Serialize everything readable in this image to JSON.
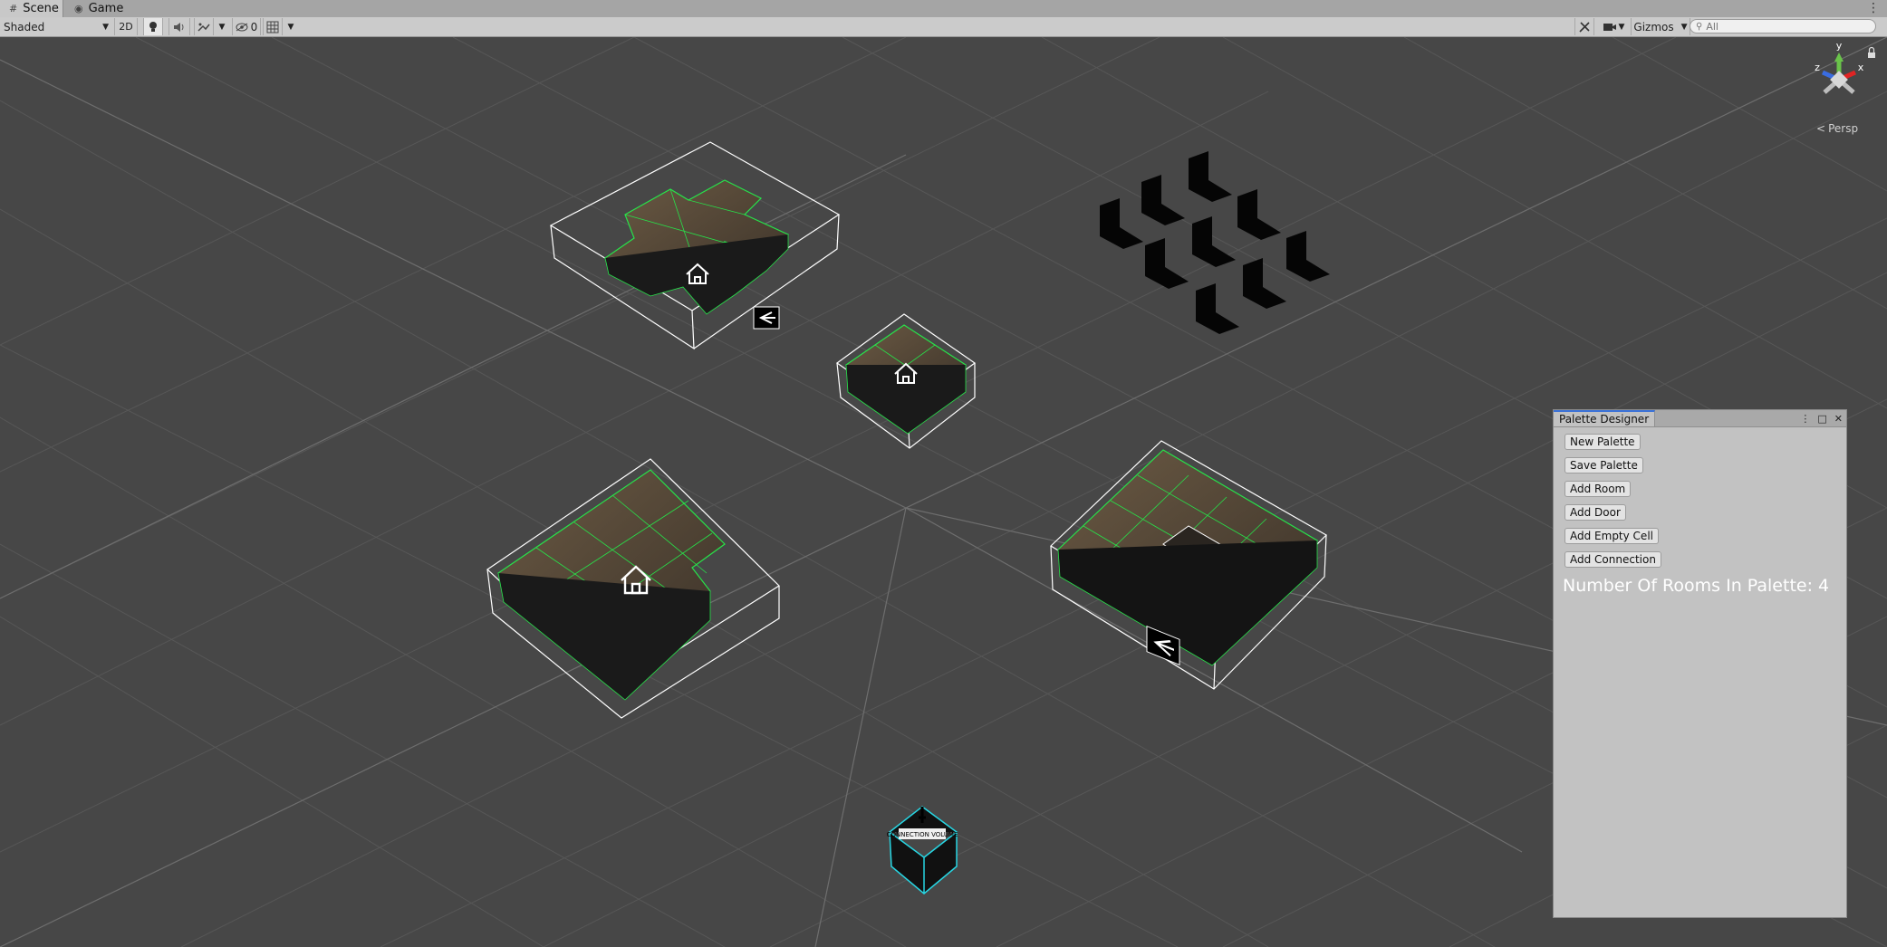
{
  "tabs": [
    {
      "label": "Scene",
      "icon": "hash-icon"
    },
    {
      "label": "Game",
      "icon": "gamepad-icon"
    }
  ],
  "toolbar": {
    "draw_mode": "Shaded",
    "mode_2d": "2D",
    "hidden_count": "0",
    "gizmos_label": "Gizmos",
    "search_placeholder": "All"
  },
  "viewport": {
    "projection_label": "Persp",
    "gizmo_axes": {
      "y": "y",
      "x": "x",
      "z": "z"
    },
    "connection_volume_text": "CONNECTION VOLUME",
    "colors": {
      "background": "#474747",
      "grid": "#595959",
      "room_outline": "#ffffff",
      "room_grid": "#27e34a",
      "connection": "#27d6e3"
    }
  },
  "palette_designer": {
    "title": "Palette Designer",
    "buttons": [
      "New Palette",
      "Save Palette",
      "Add Room",
      "Add Door",
      "Add Empty Cell",
      "Add Connection"
    ],
    "rooms_label": "Number Of Rooms In Palette: 4"
  }
}
